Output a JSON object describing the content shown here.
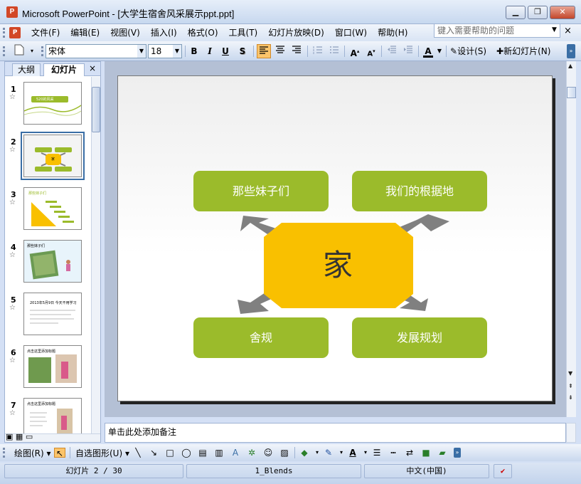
{
  "window": {
    "title": "Microsoft PowerPoint - [大学生宿舍风采展示ppt.ppt]",
    "app_icon": "P",
    "minimize": "▁",
    "restore": "❐",
    "close": "✕"
  },
  "menu": {
    "items": [
      "文件(F)",
      "编辑(E)",
      "视图(V)",
      "插入(I)",
      "格式(O)",
      "工具(T)",
      "幻灯片放映(D)",
      "窗口(W)",
      "帮助(H)"
    ],
    "help_placeholder": "键入需要帮助的问题",
    "close_doc": "×"
  },
  "toolbar": {
    "font_name": "宋体",
    "font_size": "18",
    "bold": "B",
    "italic": "I",
    "underline": "U",
    "shadow": "S",
    "design_label": "设计(S)",
    "new_slide_label": "新幻灯片(N)"
  },
  "panel": {
    "tab_outline": "大纲",
    "tab_slides": "幻灯片",
    "close": "×",
    "star": "☆",
    "thumbnails": [
      {
        "num": "1",
        "title": "520的风采"
      },
      {
        "num": "2",
        "title": "家"
      },
      {
        "num": "3",
        "title": "那些妹子们"
      },
      {
        "num": "4",
        "title": "那些妹子们"
      },
      {
        "num": "5",
        "title": "2013年5月9日 今天不用学习"
      },
      {
        "num": "6",
        "title": "点击这里添加标题"
      },
      {
        "num": "7",
        "title": "点击这里添加标题"
      }
    ]
  },
  "slide": {
    "center": "家",
    "nodes": {
      "top_left": "那些妹子们",
      "top_right": "我们的根据地",
      "bottom_left": "舍规",
      "bottom_right": "发展规划"
    },
    "colors": {
      "node_green": "#9bbb2b",
      "center_yellow": "#f9c000",
      "arrow_gray": "#808080"
    }
  },
  "notes": {
    "placeholder": "单击此处添加备注"
  },
  "drawbar": {
    "draw_label": "绘图(R)",
    "autoshapes_label": "自选图形(U)"
  },
  "status": {
    "slide_info": "幻灯片 2 / 30",
    "design": "1_Blends",
    "language": "中文(中国)"
  }
}
